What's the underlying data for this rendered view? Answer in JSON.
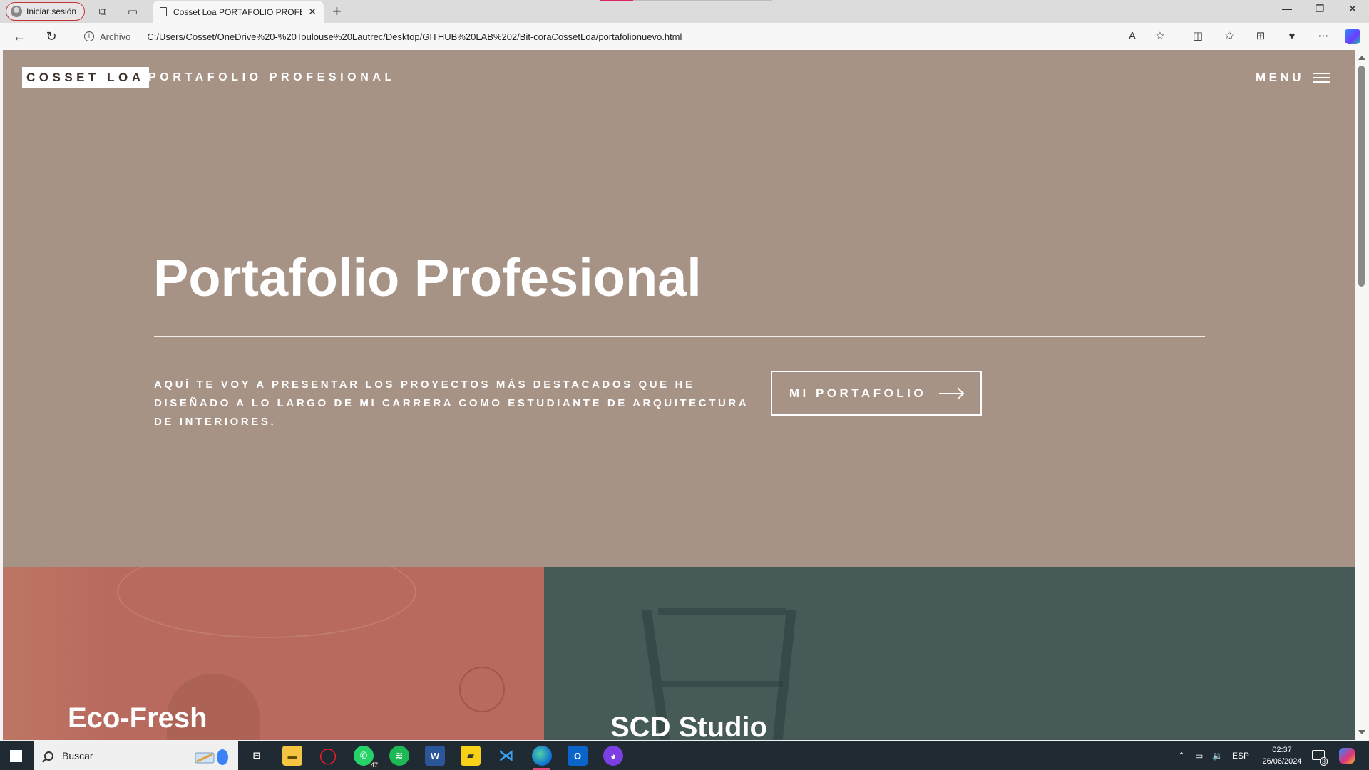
{
  "browser": {
    "profile_label": "Iniciar sesión",
    "tab_title": "Cosset Loa PORTAFOLIO PROFESIONAL",
    "address_scheme": "Archivo",
    "address_url": "C:/Users/Cosset/OneDrive%20-%20Toulouse%20Lautrec/Desktop/GITHUB%20LAB%202/Bit-coraCossetLoa/portafolionuevo.html"
  },
  "page": {
    "brand": "COSSET LOA",
    "brand_subtitle": "PORTAFOLIO PROFESIONAL",
    "menu_label": "MENU",
    "hero_title": "Portafolio Profesional",
    "hero_description": "AQUÍ TE VOY A PRESENTAR LOS PROYECTOS MÁS DESTACADOS QUE HE DISEÑADO A LO LARGO DE MI CARRERA COMO ESTUDIANTE DE ARQUITECTURA DE INTERIORES.",
    "cta_label": "MI PORTAFOLIO",
    "projects": [
      {
        "title": "Eco-Fresh"
      },
      {
        "title": "SCD Studio"
      }
    ]
  },
  "colors": {
    "hero_background": "#a69386",
    "card_eco": "#b86a5e",
    "card_scd": "#465a58"
  },
  "taskbar": {
    "search_label": "Buscar",
    "whatsapp_badge": "47",
    "language": "ESP",
    "time": "02:37",
    "date": "26/06/2024",
    "notifications": "3"
  }
}
